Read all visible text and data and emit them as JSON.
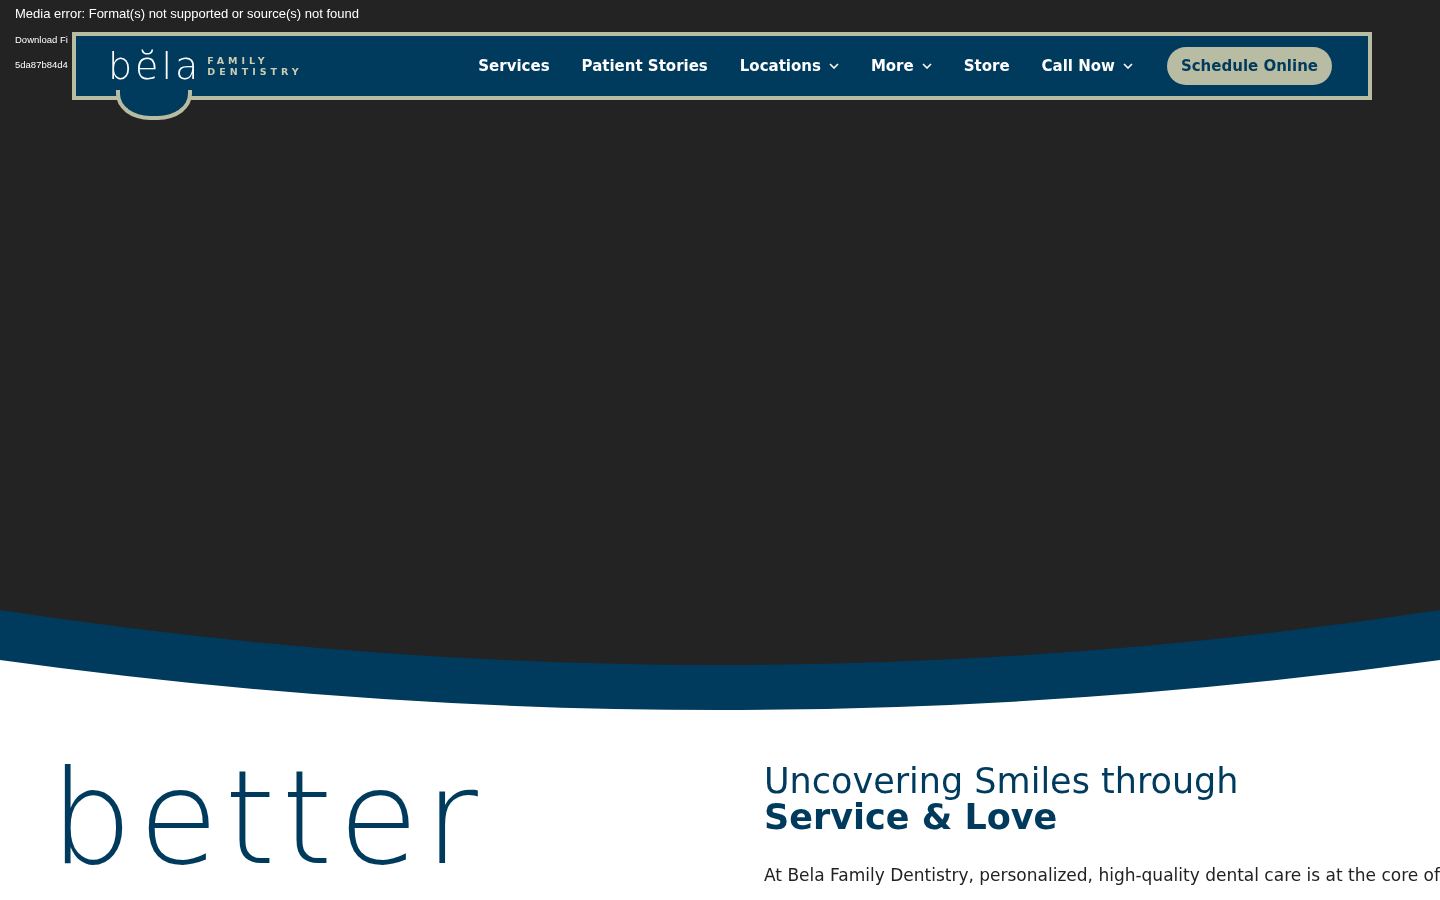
{
  "media_error": {
    "message": "Media error: Format(s) not supported or source(s) not found",
    "download_link": "Download Fi",
    "file_id": "5da87b84d4"
  },
  "header": {
    "logo": {
      "word": "bĕla",
      "line_1": "FAMILY",
      "line_2": "DENTISTRY"
    },
    "nav": [
      {
        "label": "Services",
        "dropdown": false
      },
      {
        "label": "Patient Stories",
        "dropdown": false
      },
      {
        "label": "Locations",
        "dropdown": true
      },
      {
        "label": "More",
        "dropdown": true
      },
      {
        "label": "Store",
        "dropdown": false
      },
      {
        "label": "Call Now",
        "dropdown": true
      }
    ],
    "cta": "Schedule Online"
  },
  "intro": {
    "big_word": "better",
    "heading_light": "Uncovering Smiles through",
    "heading_bold": "Service & Love",
    "paragraph": "At Bela Family Dentistry, personalized, high-quality dental care is at the core of"
  }
}
